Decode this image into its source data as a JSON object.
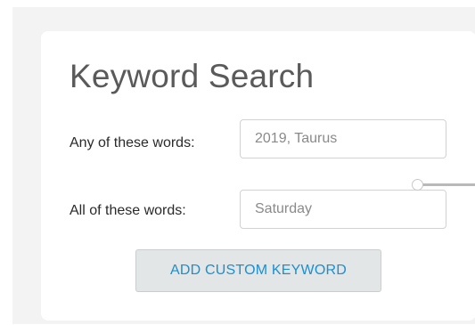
{
  "panel": {
    "title": "Keyword Search"
  },
  "fields": [
    {
      "label": "Any of these words:",
      "value": "2019, Taurus"
    },
    {
      "label": "All of these words:",
      "value": "Saturday"
    }
  ],
  "add_button": {
    "label": "ADD CUSTOM KEYWORD",
    "color": "#1b8fd0"
  },
  "connector": {
    "color": "#b9b9b9"
  }
}
